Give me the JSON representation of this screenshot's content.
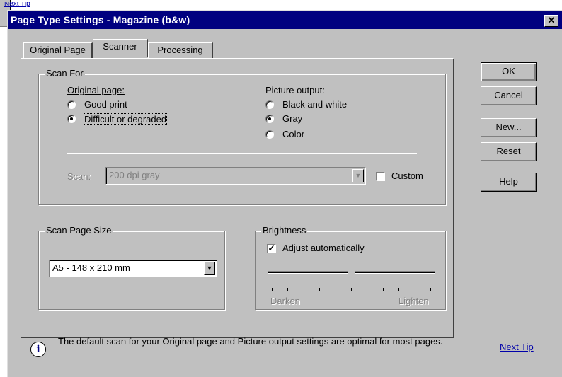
{
  "background_window": {
    "next_tip_fragment": "Next Tip"
  },
  "dialog": {
    "title": "Page Type Settings - Magazine (b&w)",
    "close_glyph": "✕",
    "tabs": [
      {
        "label": "Original Page"
      },
      {
        "label": "Scanner"
      },
      {
        "label": "Processing"
      }
    ],
    "active_tab": "Scanner"
  },
  "scan_for": {
    "legend": "Scan For",
    "original_page": {
      "heading": "Original page:",
      "options": [
        "Good print",
        "Difficult or degraded"
      ],
      "selected": "Difficult or degraded"
    },
    "picture_output": {
      "heading": "Picture output:",
      "options": [
        "Black and white",
        "Gray",
        "Color"
      ],
      "selected": "Gray"
    },
    "scan_label": "Scan:",
    "scan_value": "200 dpi gray",
    "custom_label": "Custom",
    "custom_checked": false
  },
  "scan_page_size": {
    "legend": "Scan Page Size",
    "value": "A5 - 148 x 210 mm"
  },
  "brightness": {
    "legend": "Brightness",
    "adjust_label": "Adjust automatically",
    "adjust_checked": true,
    "check_glyph": "✓",
    "min_label": "Darken",
    "max_label": "Lighten",
    "level_fraction": 0.5
  },
  "buttons": {
    "ok": "OK",
    "cancel": "Cancel",
    "new": "New...",
    "reset": "Reset",
    "help": "Help"
  },
  "tip": {
    "icon": "info-icon",
    "text": "The default scan for your Original page and Picture output settings are optimal for most pages.",
    "next_tip": "Next Tip"
  },
  "colors": {
    "face": "#c0c0c0",
    "titlebar": "#000080",
    "link": "#0000aa"
  }
}
